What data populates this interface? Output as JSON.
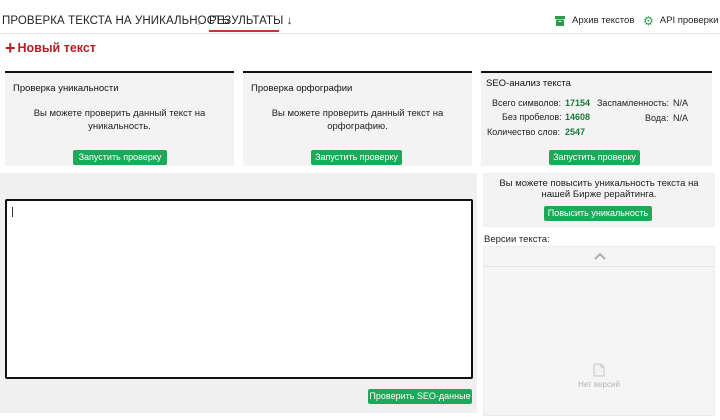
{
  "nav": {
    "check_label": "ПРОВЕРКА ТЕКСТА НА УНИКАЛЬНОСТЬ",
    "separator": "›",
    "results_label": "РЕЗУЛЬТАТЫ ↓",
    "archive_label": "Архив текстов",
    "api_label": "API проверки"
  },
  "new_text": {
    "plus": "+",
    "label": "Новый текст"
  },
  "panels": {
    "uniqueness": {
      "title": "Проверка уникальности",
      "text": "Вы можете проверить данный текст на уникальность.",
      "button": "Запустить проверку"
    },
    "spelling": {
      "title": "Проверка орфографии",
      "text": "Вы можете проверить данный текст на орфографию.",
      "button": "Запустить проверку"
    },
    "seo": {
      "title": "SEO-анализ текста",
      "total_chars_label": "Всего символов:",
      "total_chars": "17154",
      "no_spaces_label": "Без пробелов:",
      "no_spaces": "14608",
      "words_label": "Количество слов:",
      "words": "2547",
      "spam_label": "Заспамленность:",
      "spam": "N/A",
      "water_label": "Вода:",
      "water": "N/A",
      "button": "Запустить проверку"
    }
  },
  "editor": {
    "value": "",
    "seo_button": "Проверить SEO-данные"
  },
  "promo": {
    "text": "Вы можете повысить уникальность текста на нашей Бирже рерайтинга.",
    "button": "Повысить уникальность"
  },
  "versions": {
    "label": "Версии текста:",
    "empty": "Нет версий"
  },
  "colors": {
    "accent_red": "#b32025",
    "button_green": "#1ea85a",
    "value_green": "#1a7a3a"
  }
}
